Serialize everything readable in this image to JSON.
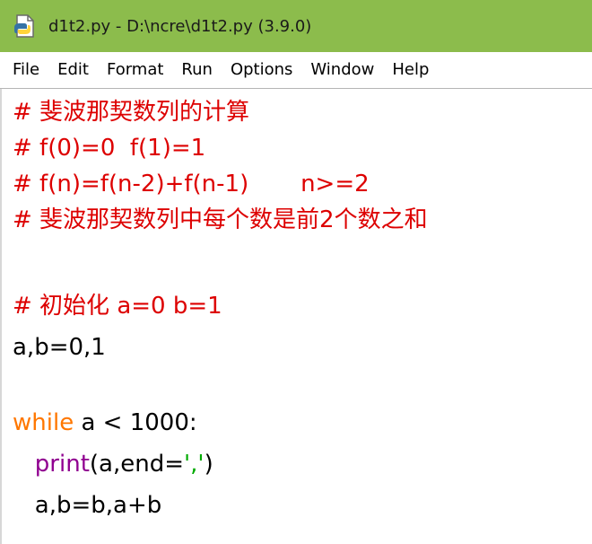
{
  "window": {
    "title": "d1t2.py - D:\\ncre\\d1t2.py (3.9.0)",
    "icon": "python-file-icon",
    "colors": {
      "titlebar": "#8cbc4c",
      "comment": "#dd0000",
      "keyword": "#ff7700",
      "builtin": "#900090",
      "string": "#00aa00"
    }
  },
  "menu": [
    "File",
    "Edit",
    "Format",
    "Run",
    "Options",
    "Window",
    "Help"
  ],
  "code": {
    "line1": "# 斐波那契数列的计算",
    "line2": "# f(0)=0  f(1)=1",
    "line3": "# f(n)=f(n-2)+f(n-1)       n>=2",
    "line4": "# 斐波那契数列中每个数是前2个数之和",
    "line6": "# 初始化 a=0 b=1",
    "line7": "a,b=0,1",
    "line9_kw": "while",
    "line9_rest": " a < 1000:",
    "line10_indent": "   ",
    "line10_fn": "print",
    "line10_open": "(a,end=",
    "line10_str": "','",
    "line10_close": ")",
    "line11": "   a,b=b,a+b"
  }
}
